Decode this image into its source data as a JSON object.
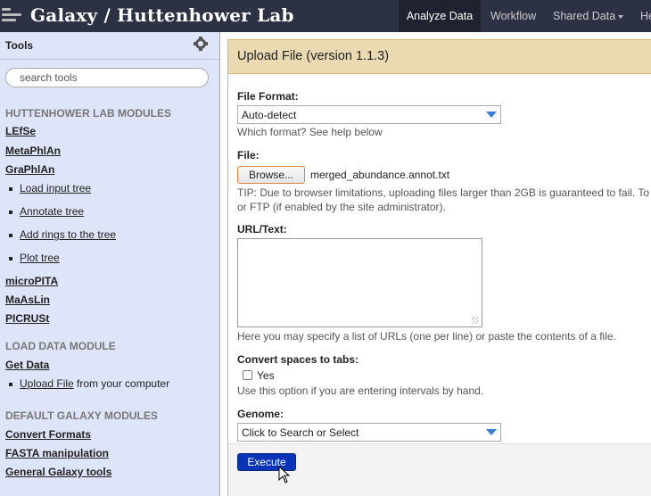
{
  "masthead": {
    "brand": "Galaxy / Huttenhower Lab",
    "nav": {
      "analyze": "Analyze Data",
      "workflow": "Workflow",
      "shared": "Shared Data",
      "help": "He"
    }
  },
  "tools_panel": {
    "title": "Tools",
    "search_placeholder": "search tools",
    "sections": {
      "huttenhower": "HUTTENHOWER LAB MODULES",
      "load_data": "LOAD DATA MODULE",
      "default_galaxy": "DEFAULT GALAXY MODULES"
    },
    "huttenhower_tools": {
      "lefse": "LEfSe",
      "metaphlan": "MetaPhlAn",
      "graphlan": "GraPhlAn",
      "graphlan_sub": [
        "Load input tree",
        "Annotate tree",
        "Add rings to the tree",
        "Plot tree"
      ],
      "micropita": "microPITA",
      "maaslin": "MaAsLin",
      "picrust": "PICRUSt"
    },
    "load_data_tools": {
      "get_data": "Get Data",
      "upload_link": "Upload File",
      "upload_suffix": " from your computer"
    },
    "default_tools": {
      "convert": "Convert Formats",
      "fasta": "FASTA manipulation",
      "general": "General Galaxy tools"
    }
  },
  "upload_form": {
    "title": "Upload File (version 1.1.3)",
    "file_format": {
      "label": "File Format:",
      "value": "Auto-detect",
      "help": "Which format? See help below"
    },
    "file": {
      "label": "File:",
      "browse_label": "Browse...",
      "file_name": "merged_abundance.annot.txt",
      "tip_line1": "TIP: Due to browser limitations, uploading files larger than 2GB is guaranteed to fail. To",
      "tip_line2": "or FTP (if enabled by the site administrator)."
    },
    "url_text": {
      "label": "URL/Text:",
      "help": "Here you may specify a list of URLs (one per line) or paste the contents of a file."
    },
    "convert_spaces": {
      "label": "Convert spaces to tabs:",
      "checkbox_label": "Yes",
      "help": "Use this option if you are entering intervals by hand."
    },
    "genome": {
      "label": "Genome:",
      "value": "Click to Search or Select"
    },
    "execute_label": "Execute"
  }
}
